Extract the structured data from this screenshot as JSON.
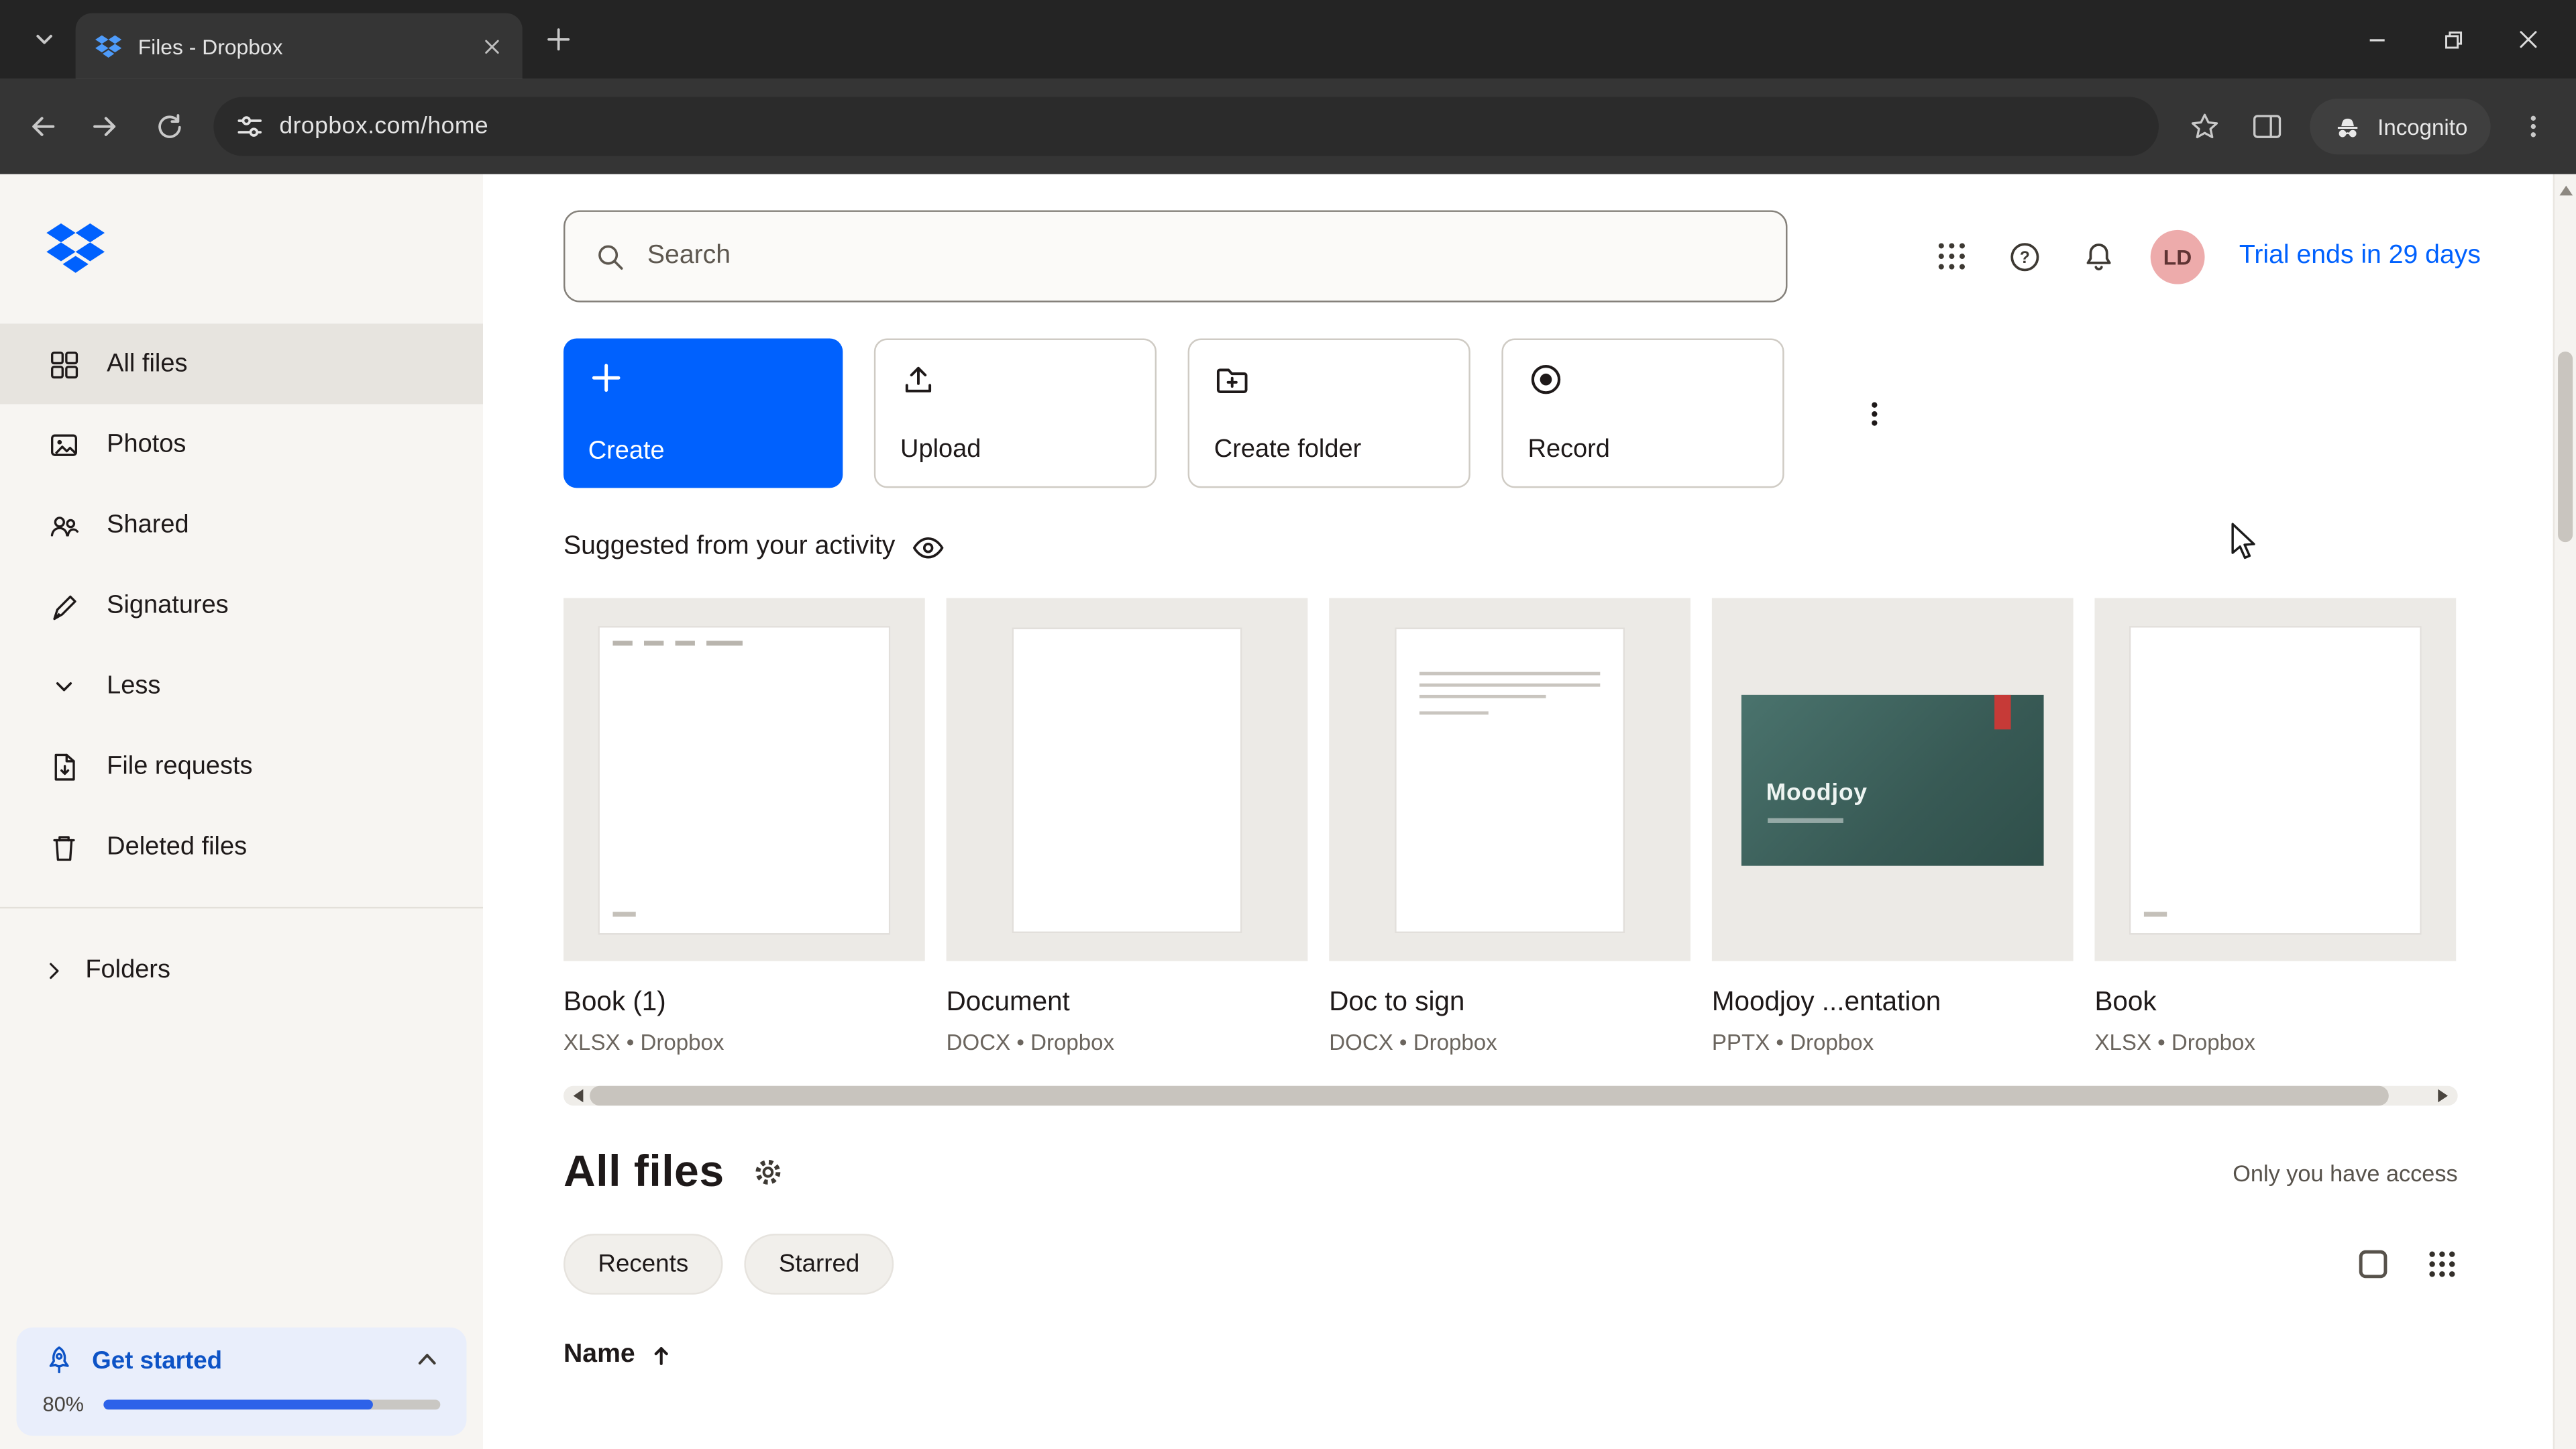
{
  "colors": {
    "accent": "#0061fe",
    "sidebar_bg": "#f7f5f2",
    "avatar_bg": "#edabab",
    "slide_teal": "#3c615c",
    "trial_link": "#0061fe"
  },
  "browser": {
    "tab_title": "Files - Dropbox",
    "url": "dropbox.com/home",
    "incognito_label": "Incognito"
  },
  "topbar": {
    "search_placeholder": "Search",
    "avatar_initials": "LD",
    "trial_text": "Trial ends in 29 days"
  },
  "actions": {
    "create": "Create",
    "upload": "Upload",
    "create_folder": "Create folder",
    "record": "Record"
  },
  "sidebar": {
    "items": [
      {
        "label": "All files"
      },
      {
        "label": "Photos"
      },
      {
        "label": "Shared"
      },
      {
        "label": "Signatures"
      },
      {
        "label": "Less"
      },
      {
        "label": "File requests"
      },
      {
        "label": "Deleted files"
      }
    ],
    "folders_label": "Folders",
    "get_started": {
      "label": "Get started",
      "percent_label": "80%",
      "bar_style": "width:80%"
    }
  },
  "suggested": {
    "title": "Suggested from your activity",
    "cards": [
      {
        "name": "Book (1)",
        "meta": "XLSX • Dropbox"
      },
      {
        "name": "Document",
        "meta": "DOCX • Dropbox"
      },
      {
        "name": "Doc to sign",
        "meta": "DOCX • Dropbox"
      },
      {
        "name": "Moodjoy ...entation",
        "meta": "PPTX • Dropbox",
        "slide_title": "Moodjoy"
      },
      {
        "name": "Book",
        "meta": "XLSX • Dropbox"
      }
    ]
  },
  "all_files": {
    "title": "All files",
    "access_text": "Only you have access",
    "filters": [
      {
        "label": "Recents"
      },
      {
        "label": "Starred"
      }
    ],
    "name_header": "Name"
  }
}
